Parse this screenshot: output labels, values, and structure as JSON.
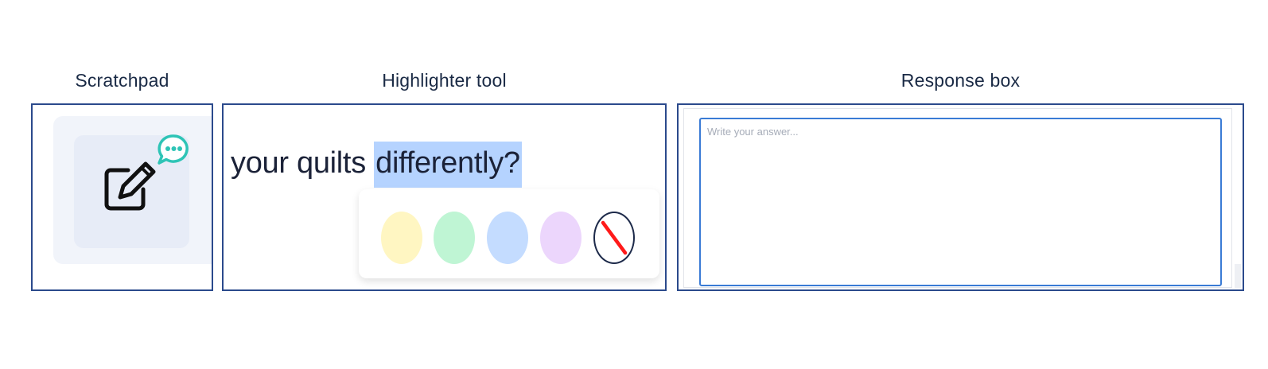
{
  "captions": {
    "scratchpad": "Scratchpad",
    "highlighter": "Highlighter tool",
    "response": "Response box"
  },
  "scratchpad": {
    "icon": "edit-pencil-square-icon",
    "badge_icon": "chat-bubble-dots-icon",
    "badge_color": "#2ec4b6"
  },
  "highlighter": {
    "text_before": "your quilts ",
    "text_highlighted": "differently?",
    "highlight_color": "#b5d3ff",
    "swatches": [
      {
        "name": "yellow",
        "color": "#fff6c2"
      },
      {
        "name": "green",
        "color": "#bff5d4"
      },
      {
        "name": "blue",
        "color": "#c4dcff"
      },
      {
        "name": "purple",
        "color": "#ecd6fc"
      },
      {
        "name": "clear",
        "icon": "no-highlight-icon",
        "strike_color": "#ff1a1a"
      }
    ]
  },
  "response": {
    "placeholder": "Write your answer...",
    "value": "",
    "border_color": "#3a7bd5"
  }
}
